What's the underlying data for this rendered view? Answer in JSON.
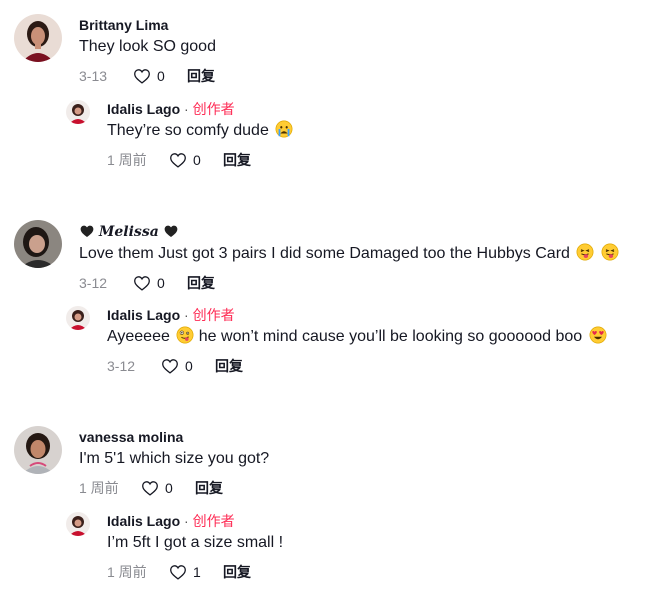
{
  "threads": [
    {
      "comment": {
        "author": "Brittany Lima",
        "text": "They look SO good",
        "time": "3-13",
        "likes": "0",
        "reply": "回复"
      },
      "reply": {
        "author": "Idalis Lago",
        "separator": "·",
        "badge": "创作者",
        "text": "They’re so comfy dude",
        "time": "1 周前",
        "likes": "0",
        "reply": "回复"
      }
    },
    {
      "comment": {
        "author": "Melissa",
        "text": "Love them Just got 3 pairs I did some Damaged too the Hubbys Card",
        "time": "3-12",
        "likes": "0",
        "reply": "回复"
      },
      "reply": {
        "author": "Idalis Lago",
        "separator": "·",
        "badge": "创作者",
        "text": "Ayeeeee",
        "text2": "he won’t mind cause you’ll be looking so goooood boo",
        "time": "3-12",
        "likes": "0",
        "reply": "回复"
      }
    },
    {
      "comment": {
        "author": "vanessa molina",
        "text": "I'm 5'1 which size you got?",
        "time": "1 周前",
        "likes": "0",
        "reply": "回复"
      },
      "reply": {
        "author": "Idalis Lago",
        "separator": "·",
        "badge": "创作者",
        "text": "I’m 5ft I got a size small !",
        "time": "1 周前",
        "likes": "1",
        "reply": "回复"
      }
    }
  ],
  "colors": {
    "creator_badge": "#fe2c55",
    "meta_gray": "#8a8b91",
    "text": "#161823"
  },
  "icons": [
    "heart-outline-icon",
    "crying-face-emoji",
    "tongue-face-emoji",
    "zany-face-emoji",
    "heart-eyes-emoji",
    "black-heart-icon"
  ]
}
